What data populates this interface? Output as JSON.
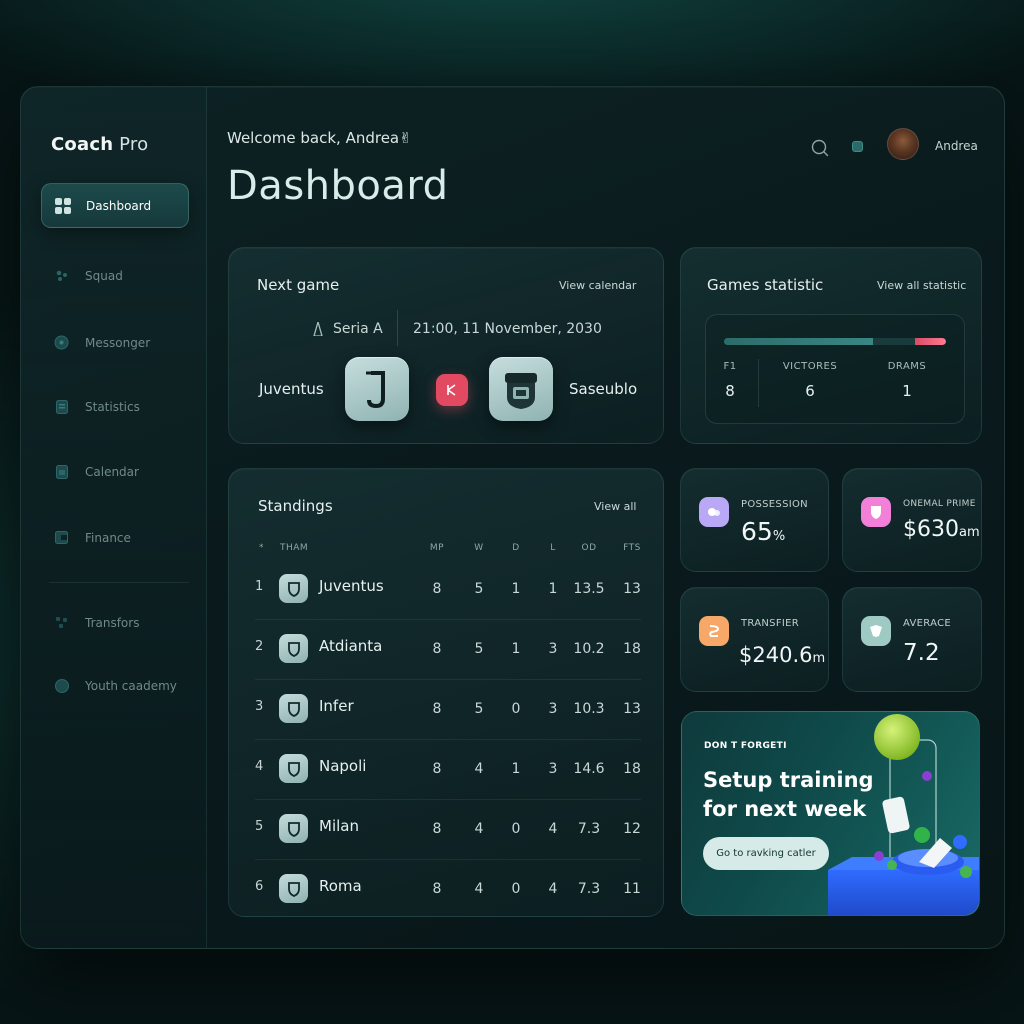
{
  "sidebar": {
    "brand_bold": "Coach",
    "brand_light": "Pro",
    "items": [
      {
        "label": "Dashboard",
        "icon": "grid-icon"
      },
      {
        "label": "Squad",
        "icon": "users-icon"
      },
      {
        "label": "Messonger",
        "icon": "chat-icon"
      },
      {
        "label": "Statistics",
        "icon": "chart-icon"
      },
      {
        "label": "Calendar",
        "icon": "calendar-icon"
      },
      {
        "label": "Finance",
        "icon": "wallet-icon"
      },
      {
        "label": "Transfors",
        "icon": "transfer-icon"
      },
      {
        "label": "Youth caademy",
        "icon": "academy-icon"
      }
    ]
  },
  "header": {
    "welcome": "Welcome back, Andrea✌",
    "title": "Dashboard",
    "user_name": "Andrea"
  },
  "next_game": {
    "title": "Next game",
    "link": "View calendar",
    "league": "Seria A",
    "datetime": "21:00, 11 November, 2030",
    "home_team": "Juventus",
    "away_team": "Saseublo"
  },
  "games_statistic": {
    "title": "Games statistic",
    "link": "View all statistic",
    "bar": {
      "wins_fraction": 0.67,
      "draws_fraction": 0.14
    },
    "columns": [
      {
        "label": "F1",
        "value": "8"
      },
      {
        "label": "VICTORES",
        "value": "6"
      },
      {
        "label": "DRAMS",
        "value": "1"
      }
    ]
  },
  "standings": {
    "title": "Standings",
    "link": "View all",
    "headers": {
      "rank": "*",
      "team": "THAM",
      "mp": "MP",
      "w": "W",
      "d": "D",
      "l": "L",
      "od": "OD",
      "pts": "FTS"
    },
    "rows": [
      {
        "rank": "1",
        "team": "Juventus",
        "mp": "8",
        "w": "5",
        "d": "1",
        "l": "1",
        "od": "13.5",
        "pts": "13"
      },
      {
        "rank": "2",
        "team": "Atdianta",
        "mp": "8",
        "w": "5",
        "d": "1",
        "l": "3",
        "od": "10.2",
        "pts": "18"
      },
      {
        "rank": "3",
        "team": "Infer",
        "mp": "8",
        "w": "5",
        "d": "0",
        "l": "3",
        "od": "10.3",
        "pts": "13"
      },
      {
        "rank": "4",
        "team": "Napoli",
        "mp": "8",
        "w": "4",
        "d": "1",
        "l": "3",
        "od": "14.6",
        "pts": "18"
      },
      {
        "rank": "5",
        "team": "Milan",
        "mp": "8",
        "w": "4",
        "d": "0",
        "l": "4",
        "od": "7.3",
        "pts": "12"
      },
      {
        "rank": "6",
        "team": "Roma",
        "mp": "8",
        "w": "4",
        "d": "0",
        "l": "4",
        "od": "7.3",
        "pts": "11"
      }
    ]
  },
  "kpis": [
    {
      "label": "POSSESSION",
      "value": "65",
      "prefix": "",
      "suffix": "%",
      "color": "#b9a8f5"
    },
    {
      "label": "ONEMAL PRIME",
      "value": "630",
      "prefix": "$",
      "suffix": "am",
      "color": "#f27fd8"
    },
    {
      "label": "TRANSFIER",
      "value": "240.6",
      "prefix": "$",
      "suffix": "m",
      "color": "#f7a768"
    },
    {
      "label": "AVERACE",
      "value": "7.2",
      "prefix": "",
      "suffix": "",
      "color": "#9fc9c3"
    }
  ],
  "promo": {
    "kicker": "DON T FORGETI",
    "title": "Setup training for next week",
    "button": "Go to ravking catler"
  },
  "colors": {
    "accent": "#e24a62",
    "teal": "#1c4a4b",
    "background": "#071516"
  }
}
